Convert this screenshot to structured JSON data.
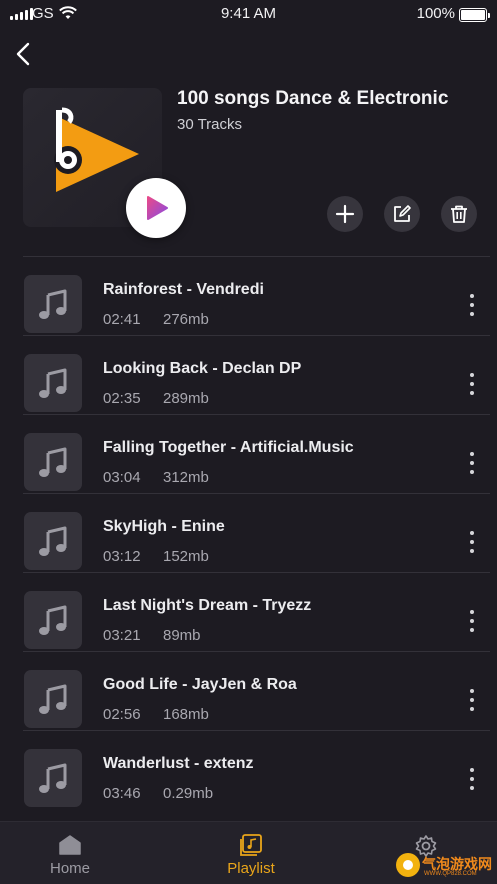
{
  "status_bar": {
    "carrier": "GS",
    "time": "9:41 AM",
    "battery": "100%"
  },
  "playlist": {
    "title": "100 songs Dance & Electronic",
    "track_count": "30 Tracks"
  },
  "tracks": [
    {
      "title": "Rainforest - Vendredi",
      "duration": "02:41",
      "size": "276mb"
    },
    {
      "title": "Looking Back - Declan DP",
      "duration": "02:35",
      "size": "289mb"
    },
    {
      "title": "Falling Together - Artificial.Music",
      "duration": "03:04",
      "size": "312mb"
    },
    {
      "title": "SkyHigh - Enine",
      "duration": "03:12",
      "size": "152mb"
    },
    {
      "title": "Last Night's Dream - Tryezz",
      "duration": "03:21",
      "size": "89mb"
    },
    {
      "title": "Good Life - JayJen & Roa",
      "duration": "02:56",
      "size": "168mb"
    },
    {
      "title": "Wanderlust - extenz",
      "duration": "03:46",
      "size": "0.29mb"
    }
  ],
  "tab_bar": {
    "home": "Home",
    "playlist": "Playlist",
    "active": "playlist"
  },
  "watermark": {
    "text": "气泡游戏网",
    "url": "WWW.QP828.COM"
  },
  "colors": {
    "background": "#1d1b22",
    "accent": "#e9a51a",
    "logo_orange": "#f39c12"
  },
  "icons": {
    "back": "chevron-left-icon",
    "add": "plus-icon",
    "edit": "edit-icon",
    "delete": "trash-icon",
    "track_thumb": "music-note-icon",
    "more": "vertical-dots-icon",
    "home": "home-icon",
    "playlist": "playlist-icon",
    "settings": "gear-icon"
  }
}
